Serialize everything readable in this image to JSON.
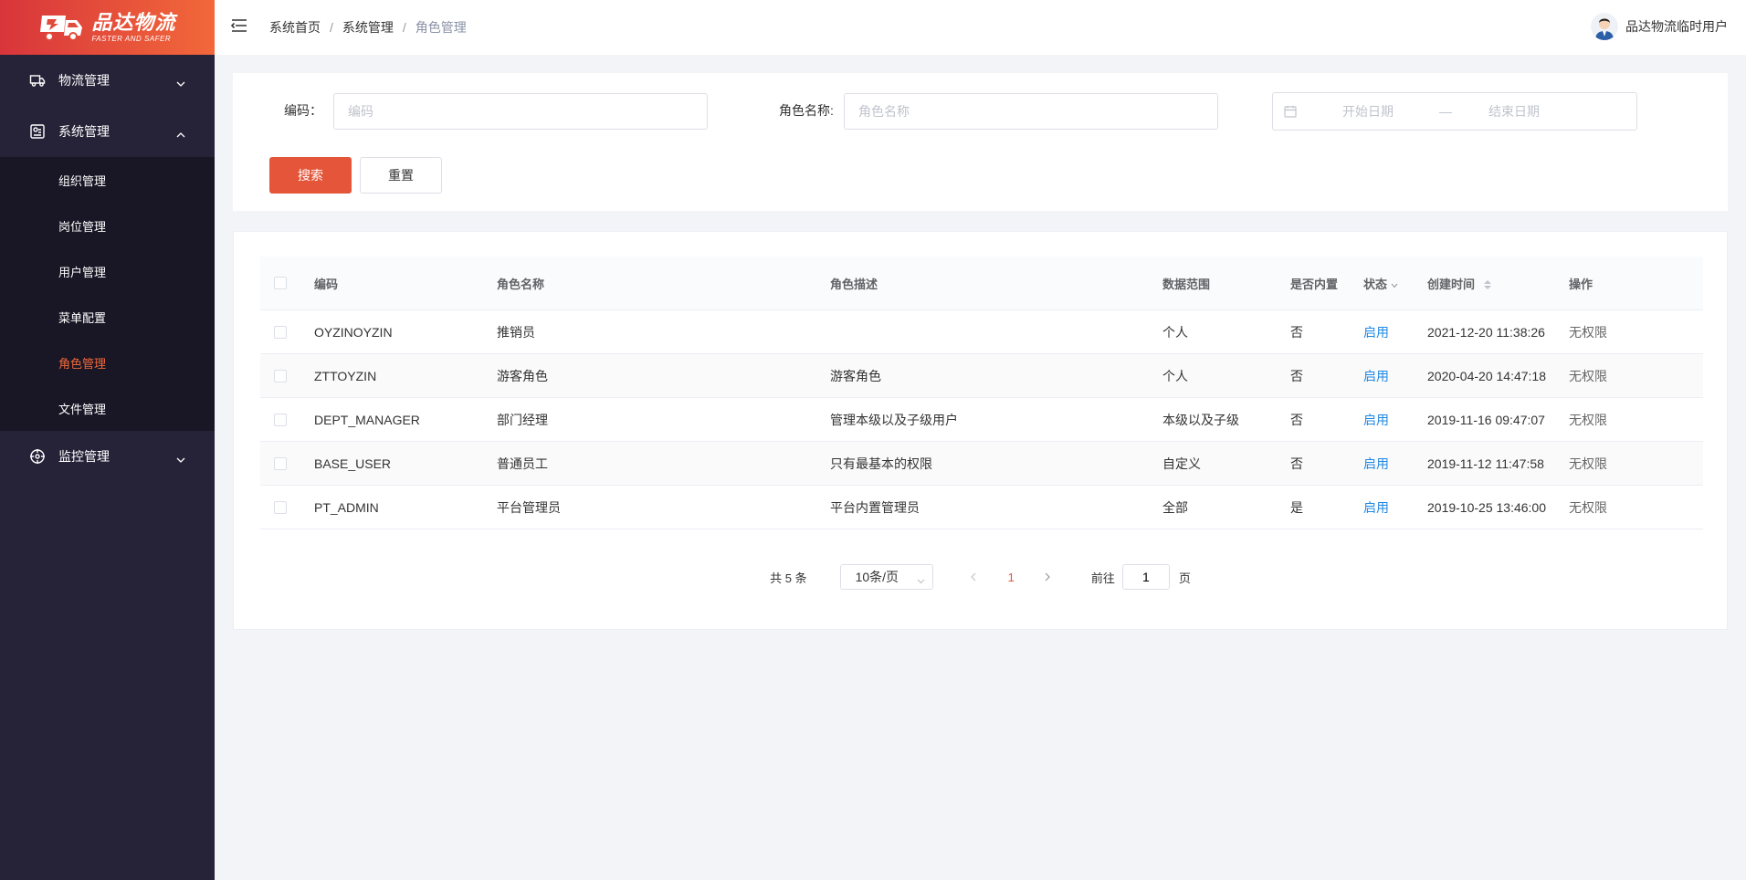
{
  "brand": {
    "name_cn": "品达物流",
    "slogan": "FASTER AND SAFER",
    "colors": {
      "gradient_start": "#d8353b",
      "gradient_end": "#f2683a"
    }
  },
  "sidebar": {
    "groups": [
      {
        "label": "物流管理",
        "icon": "truck-icon",
        "expanded": false
      },
      {
        "label": "系统管理",
        "icon": "settings-doc-icon",
        "expanded": true,
        "items": [
          {
            "label": "组织管理",
            "active": false
          },
          {
            "label": "岗位管理",
            "active": false
          },
          {
            "label": "用户管理",
            "active": false
          },
          {
            "label": "菜单配置",
            "active": false
          },
          {
            "label": "角色管理",
            "active": true
          },
          {
            "label": "文件管理",
            "active": false
          }
        ]
      },
      {
        "label": "监控管理",
        "icon": "crosshair-icon",
        "expanded": false
      }
    ],
    "colors": {
      "bg": "#262338",
      "submenu_bg": "#191625",
      "active": "#f2683a"
    }
  },
  "header": {
    "breadcrumb": [
      "系统首页",
      "系统管理",
      "角色管理"
    ],
    "separator": "/",
    "user_name": "品达物流临时用户"
  },
  "search": {
    "code_label": "编码：",
    "code_placeholder": "编码",
    "code_value": "",
    "role_name_label": "角色名称:",
    "role_name_placeholder": "角色名称",
    "role_name_value": "",
    "date_start_placeholder": "开始日期",
    "date_separator": "—",
    "date_end_placeholder": "结束日期",
    "search_button": "搜索",
    "reset_button": "重置"
  },
  "table": {
    "headers": {
      "code": "编码",
      "name": "角色名称",
      "desc": "角色描述",
      "scope": "数据范围",
      "builtin": "是否内置",
      "status": "状态",
      "time": "创建时间",
      "op": "操作"
    },
    "rows": [
      {
        "code": "OYZINOYZIN",
        "name": "推销员",
        "desc": "",
        "scope": "个人",
        "builtin": "否",
        "status": "启用",
        "time": "2021-12-20 11:38:26",
        "op": "无权限"
      },
      {
        "code": "ZTTOYZIN",
        "name": "游客角色",
        "desc": "游客角色",
        "scope": "个人",
        "builtin": "否",
        "status": "启用",
        "time": "2020-04-20 14:47:18",
        "op": "无权限"
      },
      {
        "code": "DEPT_MANAGER",
        "name": "部门经理",
        "desc": "管理本级以及子级用户",
        "scope": "本级以及子级",
        "builtin": "否",
        "status": "启用",
        "time": "2019-11-16 09:47:07",
        "op": "无权限"
      },
      {
        "code": "BASE_USER",
        "name": "普通员工",
        "desc": "只有最基本的权限",
        "scope": "自定义",
        "builtin": "否",
        "status": "启用",
        "time": "2019-11-12 11:47:58",
        "op": "无权限"
      },
      {
        "code": "PT_ADMIN",
        "name": "平台管理员",
        "desc": "平台内置管理员",
        "scope": "全部",
        "builtin": "是",
        "status": "启用",
        "time": "2019-10-25 13:46:00",
        "op": "无权限"
      }
    ]
  },
  "pagination": {
    "total_text": "共 5 条",
    "page_size": "10条/页",
    "current_page": "1",
    "goto_label": "前往",
    "goto_value": "1",
    "goto_suffix": "页"
  },
  "colors": {
    "primary": "#e4553a",
    "link": "#1e88e5",
    "page_bg": "#f3f4f7"
  }
}
